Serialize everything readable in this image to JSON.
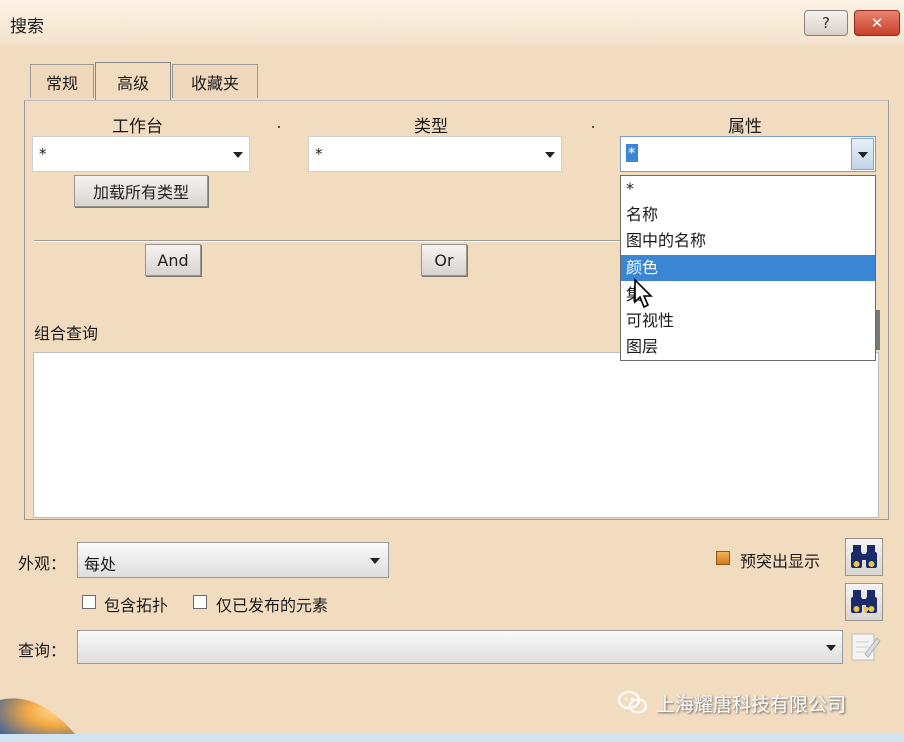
{
  "window": {
    "title": "搜索",
    "help_label": "?",
    "close_label": "✕"
  },
  "tabs": [
    {
      "label": "常规",
      "active": false
    },
    {
      "label": "高级",
      "active": true
    },
    {
      "label": "收藏夹",
      "active": false
    }
  ],
  "advanced": {
    "workbench_label": "工作台",
    "type_label": "类型",
    "attribute_label": "属性",
    "workbench_value": "*",
    "type_value": "*",
    "attribute_value": "*",
    "load_all_types_label": "加载所有类型",
    "and_label": "And",
    "or_label": "Or",
    "combined_query_label": "组合查询",
    "combined_query_value": ""
  },
  "attribute_dropdown": {
    "options": [
      "*",
      "名称",
      "图中的名称",
      "颜色",
      "集",
      "可视性",
      "图层"
    ],
    "highlighted": "颜色"
  },
  "appearance": {
    "label": "外观：",
    "value": "每处"
  },
  "preview_highlight": {
    "label": "预突出显示",
    "checked": true
  },
  "include_topology": {
    "label": "包含拓扑",
    "checked": false
  },
  "published_only": {
    "label": "仅已发布的元素",
    "checked": false
  },
  "query": {
    "label": "查询：",
    "value": ""
  },
  "watermark": {
    "text": "上海耀唐科技有限公司"
  },
  "colors": {
    "accent": "#3a86d4",
    "background": "#f2dcc0",
    "close": "#c8402a",
    "binocular": "#1a2a6b"
  }
}
